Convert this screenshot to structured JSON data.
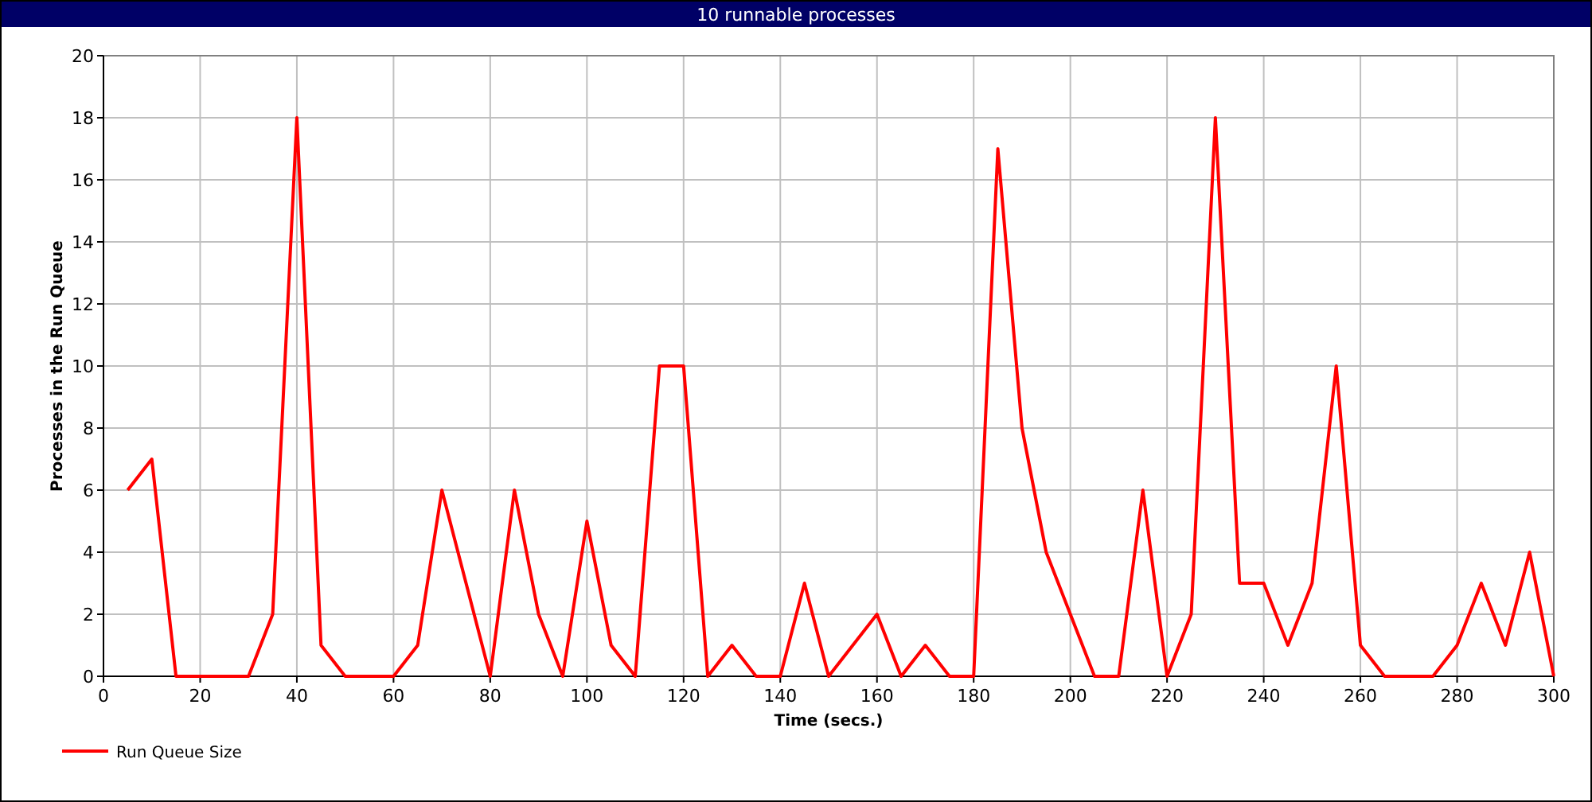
{
  "window": {
    "title": "10 runnable processes"
  },
  "chart": {
    "chart_data": {
      "type": "line",
      "xlabel": "Time (secs.)",
      "ylabel": "Processes in the Run Queue",
      "x": [
        5,
        10,
        15,
        20,
        25,
        30,
        35,
        40,
        45,
        50,
        55,
        60,
        65,
        70,
        75,
        80,
        85,
        90,
        95,
        100,
        105,
        110,
        115,
        120,
        125,
        130,
        135,
        140,
        145,
        150,
        155,
        160,
        165,
        170,
        175,
        180,
        185,
        190,
        195,
        200,
        205,
        210,
        215,
        220,
        225,
        230,
        235,
        240,
        245,
        250,
        255,
        260,
        265,
        270,
        275,
        280,
        285,
        290,
        295,
        300
      ],
      "series": [
        {
          "name": "Run Queue Size",
          "color": "#ff0000",
          "values": [
            6,
            7,
            0,
            0,
            0,
            0,
            2,
            18,
            1,
            0,
            0,
            0,
            1,
            6,
            3,
            0,
            6,
            2,
            0,
            5,
            1,
            0,
            10,
            10,
            0,
            1,
            0,
            0,
            3,
            0,
            1,
            2,
            0,
            1,
            0,
            0,
            17,
            8,
            4,
            2,
            0,
            0,
            6,
            0,
            2,
            18,
            3,
            3,
            1,
            3,
            10,
            1,
            0,
            0,
            0,
            1,
            3,
            1,
            4,
            0
          ]
        }
      ],
      "xlim": [
        0,
        300
      ],
      "ylim": [
        0,
        20
      ],
      "xticks": [
        0,
        20,
        40,
        60,
        80,
        100,
        120,
        140,
        160,
        180,
        200,
        220,
        240,
        260,
        280,
        300
      ],
      "yticks": [
        0,
        2,
        4,
        6,
        8,
        10,
        12,
        14,
        16,
        18,
        20
      ],
      "grid": true
    }
  }
}
